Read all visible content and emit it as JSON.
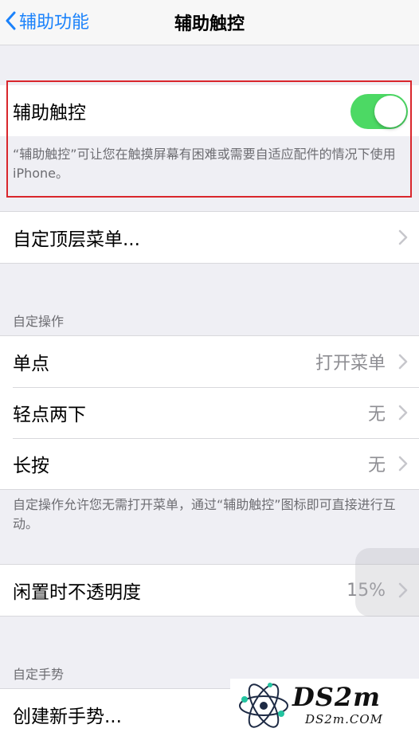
{
  "nav": {
    "back_label": "辅助功能",
    "title": "辅助触控"
  },
  "assistive_touch": {
    "label": "辅助触控",
    "enabled": true,
    "description": "“辅助触控”可让您在触摸屏幕有困难或需要自适应配件的情况下使用 iPhone。"
  },
  "top_menu": {
    "label": "自定顶层菜单..."
  },
  "custom_actions": {
    "header": "自定操作",
    "rows": [
      {
        "label": "单点",
        "value": "打开菜单"
      },
      {
        "label": "轻点两下",
        "value": "无"
      },
      {
        "label": "长按",
        "value": "无"
      }
    ],
    "footer": "自定操作允许您无需打开菜单，通过“辅助触控”图标即可直接进行互动。"
  },
  "idle_opacity": {
    "label": "闲置时不透明度",
    "value": "15%"
  },
  "custom_gestures": {
    "header": "自定手势",
    "create_label": "创建新手势..."
  },
  "watermark": {
    "big": "DS2m",
    "small": "DS2m.COM"
  },
  "colors": {
    "accent": "#1a82fb",
    "toggle_on": "#4cd964",
    "highlight": "#d9262c"
  }
}
